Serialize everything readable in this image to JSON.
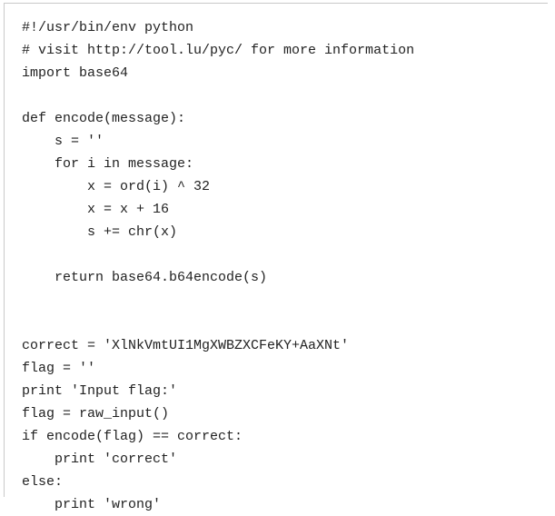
{
  "code": {
    "lines": [
      "#!/usr/bin/env python",
      "# visit http://tool.lu/pyc/ for more information",
      "import base64",
      "",
      "def encode(message):",
      "    s = ''",
      "    for i in message:",
      "        x = ord(i) ^ 32",
      "        x = x + 16",
      "        s += chr(x)",
      "",
      "    return base64.b64encode(s)",
      "",
      "",
      "correct = 'XlNkVmtUI1MgXWBZXCFeKY+AaXNt'",
      "flag = ''",
      "print 'Input flag:'",
      "flag = raw_input()",
      "if encode(flag) == correct:",
      "    print 'correct'",
      "else:",
      "    print 'wrong'"
    ]
  }
}
